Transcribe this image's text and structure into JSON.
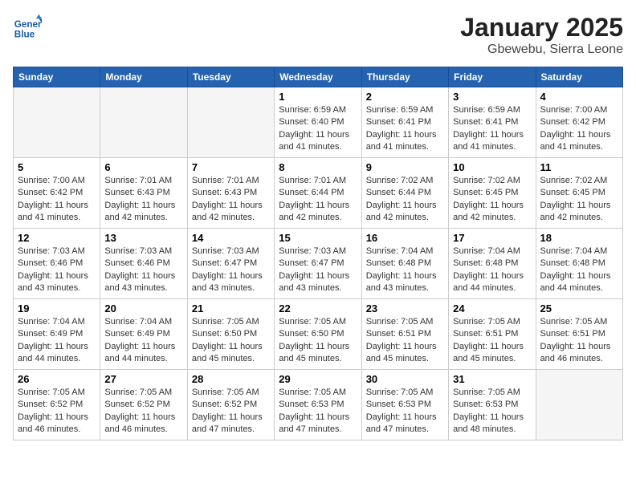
{
  "header": {
    "logo_line1": "General",
    "logo_line2": "Blue",
    "month_title": "January 2025",
    "location": "Gbewebu, Sierra Leone"
  },
  "weekdays": [
    "Sunday",
    "Monday",
    "Tuesday",
    "Wednesday",
    "Thursday",
    "Friday",
    "Saturday"
  ],
  "weeks": [
    [
      {
        "day": "",
        "empty": true
      },
      {
        "day": "",
        "empty": true
      },
      {
        "day": "",
        "empty": true
      },
      {
        "day": "1",
        "sunrise": "6:59 AM",
        "sunset": "6:40 PM",
        "daylight": "11 hours and 41 minutes."
      },
      {
        "day": "2",
        "sunrise": "6:59 AM",
        "sunset": "6:41 PM",
        "daylight": "11 hours and 41 minutes."
      },
      {
        "day": "3",
        "sunrise": "6:59 AM",
        "sunset": "6:41 PM",
        "daylight": "11 hours and 41 minutes."
      },
      {
        "day": "4",
        "sunrise": "7:00 AM",
        "sunset": "6:42 PM",
        "daylight": "11 hours and 41 minutes."
      }
    ],
    [
      {
        "day": "5",
        "sunrise": "7:00 AM",
        "sunset": "6:42 PM",
        "daylight": "11 hours and 41 minutes."
      },
      {
        "day": "6",
        "sunrise": "7:01 AM",
        "sunset": "6:43 PM",
        "daylight": "11 hours and 42 minutes."
      },
      {
        "day": "7",
        "sunrise": "7:01 AM",
        "sunset": "6:43 PM",
        "daylight": "11 hours and 42 minutes."
      },
      {
        "day": "8",
        "sunrise": "7:01 AM",
        "sunset": "6:44 PM",
        "daylight": "11 hours and 42 minutes."
      },
      {
        "day": "9",
        "sunrise": "7:02 AM",
        "sunset": "6:44 PM",
        "daylight": "11 hours and 42 minutes."
      },
      {
        "day": "10",
        "sunrise": "7:02 AM",
        "sunset": "6:45 PM",
        "daylight": "11 hours and 42 minutes."
      },
      {
        "day": "11",
        "sunrise": "7:02 AM",
        "sunset": "6:45 PM",
        "daylight": "11 hours and 42 minutes."
      }
    ],
    [
      {
        "day": "12",
        "sunrise": "7:03 AM",
        "sunset": "6:46 PM",
        "daylight": "11 hours and 43 minutes."
      },
      {
        "day": "13",
        "sunrise": "7:03 AM",
        "sunset": "6:46 PM",
        "daylight": "11 hours and 43 minutes."
      },
      {
        "day": "14",
        "sunrise": "7:03 AM",
        "sunset": "6:47 PM",
        "daylight": "11 hours and 43 minutes."
      },
      {
        "day": "15",
        "sunrise": "7:03 AM",
        "sunset": "6:47 PM",
        "daylight": "11 hours and 43 minutes."
      },
      {
        "day": "16",
        "sunrise": "7:04 AM",
        "sunset": "6:48 PM",
        "daylight": "11 hours and 43 minutes."
      },
      {
        "day": "17",
        "sunrise": "7:04 AM",
        "sunset": "6:48 PM",
        "daylight": "11 hours and 44 minutes."
      },
      {
        "day": "18",
        "sunrise": "7:04 AM",
        "sunset": "6:48 PM",
        "daylight": "11 hours and 44 minutes."
      }
    ],
    [
      {
        "day": "19",
        "sunrise": "7:04 AM",
        "sunset": "6:49 PM",
        "daylight": "11 hours and 44 minutes."
      },
      {
        "day": "20",
        "sunrise": "7:04 AM",
        "sunset": "6:49 PM",
        "daylight": "11 hours and 44 minutes."
      },
      {
        "day": "21",
        "sunrise": "7:05 AM",
        "sunset": "6:50 PM",
        "daylight": "11 hours and 45 minutes."
      },
      {
        "day": "22",
        "sunrise": "7:05 AM",
        "sunset": "6:50 PM",
        "daylight": "11 hours and 45 minutes."
      },
      {
        "day": "23",
        "sunrise": "7:05 AM",
        "sunset": "6:51 PM",
        "daylight": "11 hours and 45 minutes."
      },
      {
        "day": "24",
        "sunrise": "7:05 AM",
        "sunset": "6:51 PM",
        "daylight": "11 hours and 45 minutes."
      },
      {
        "day": "25",
        "sunrise": "7:05 AM",
        "sunset": "6:51 PM",
        "daylight": "11 hours and 46 minutes."
      }
    ],
    [
      {
        "day": "26",
        "sunrise": "7:05 AM",
        "sunset": "6:52 PM",
        "daylight": "11 hours and 46 minutes."
      },
      {
        "day": "27",
        "sunrise": "7:05 AM",
        "sunset": "6:52 PM",
        "daylight": "11 hours and 46 minutes."
      },
      {
        "day": "28",
        "sunrise": "7:05 AM",
        "sunset": "6:52 PM",
        "daylight": "11 hours and 47 minutes."
      },
      {
        "day": "29",
        "sunrise": "7:05 AM",
        "sunset": "6:53 PM",
        "daylight": "11 hours and 47 minutes."
      },
      {
        "day": "30",
        "sunrise": "7:05 AM",
        "sunset": "6:53 PM",
        "daylight": "11 hours and 47 minutes."
      },
      {
        "day": "31",
        "sunrise": "7:05 AM",
        "sunset": "6:53 PM",
        "daylight": "11 hours and 48 minutes."
      },
      {
        "day": "",
        "empty": true
      }
    ]
  ]
}
